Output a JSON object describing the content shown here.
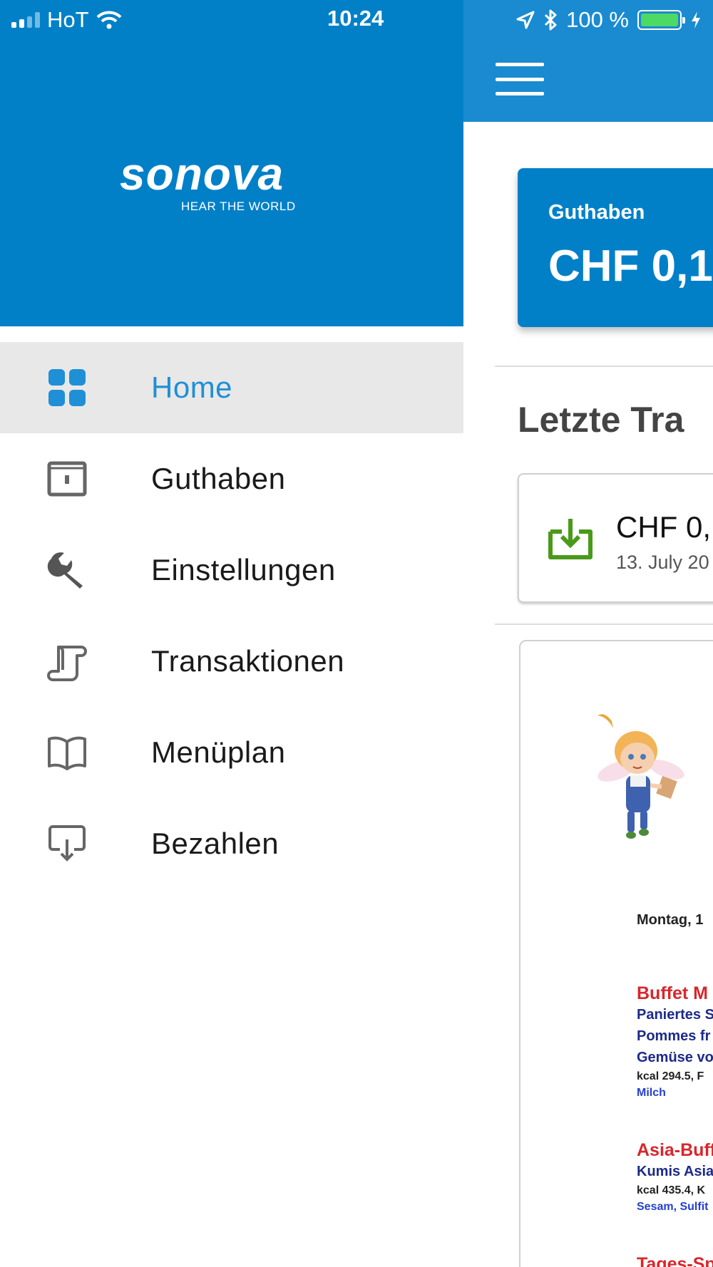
{
  "status_bar": {
    "carrier": "HoT",
    "time": "10:24",
    "battery": "100 %",
    "battery_level": 1.0,
    "icons": [
      "signal-icon",
      "wifi-icon",
      "location-icon",
      "bluetooth-icon",
      "battery-icon",
      "charging-icon"
    ]
  },
  "drawer": {
    "logo": {
      "word": "sonova",
      "tagline": "HEAR THE WORLD"
    },
    "items": [
      {
        "label": "Home",
        "icon": "grid-icon",
        "active": true
      },
      {
        "label": "Guthaben",
        "icon": "wallet-icon",
        "active": false
      },
      {
        "label": "Einstellungen",
        "icon": "wrench-icon",
        "active": false
      },
      {
        "label": "Transaktionen",
        "icon": "scroll-icon",
        "active": false
      },
      {
        "label": "Menüplan",
        "icon": "book-icon",
        "active": false
      },
      {
        "label": "Bezahlen",
        "icon": "pay-terminal-icon",
        "active": false
      }
    ]
  },
  "main": {
    "balance": {
      "label": "Guthaben",
      "value": "CHF 0,1"
    },
    "section_title": "Letzte Tra",
    "transaction": {
      "amount": "CHF 0,",
      "date": "13. July 20",
      "icon": "deposit-icon"
    },
    "menu_document": {
      "day": "Montag, 1",
      "blocks": [
        {
          "heading": "Buffet M",
          "lines": [
            "Paniertes S",
            "Pommes fr",
            "Gemüse vo"
          ],
          "small": "kcal 294.5, F",
          "allergens": "Milch"
        },
        {
          "heading": "Asia-Buff",
          "lines": [
            "Kumis Asia"
          ],
          "small": "kcal 435.4, K",
          "allergens": "Sesam, Sulfit"
        },
        {
          "heading": "Tages-Sp",
          "lines": [],
          "small": "",
          "allergens": ""
        }
      ]
    }
  },
  "colors": {
    "brand_blue": "#0180c8",
    "header_blue": "#1a8bd0",
    "active_blue": "#1f8fd6",
    "deposit_green": "#4a9a1a",
    "doc_red": "#d9262c",
    "doc_navy": "#1c2a8a"
  }
}
